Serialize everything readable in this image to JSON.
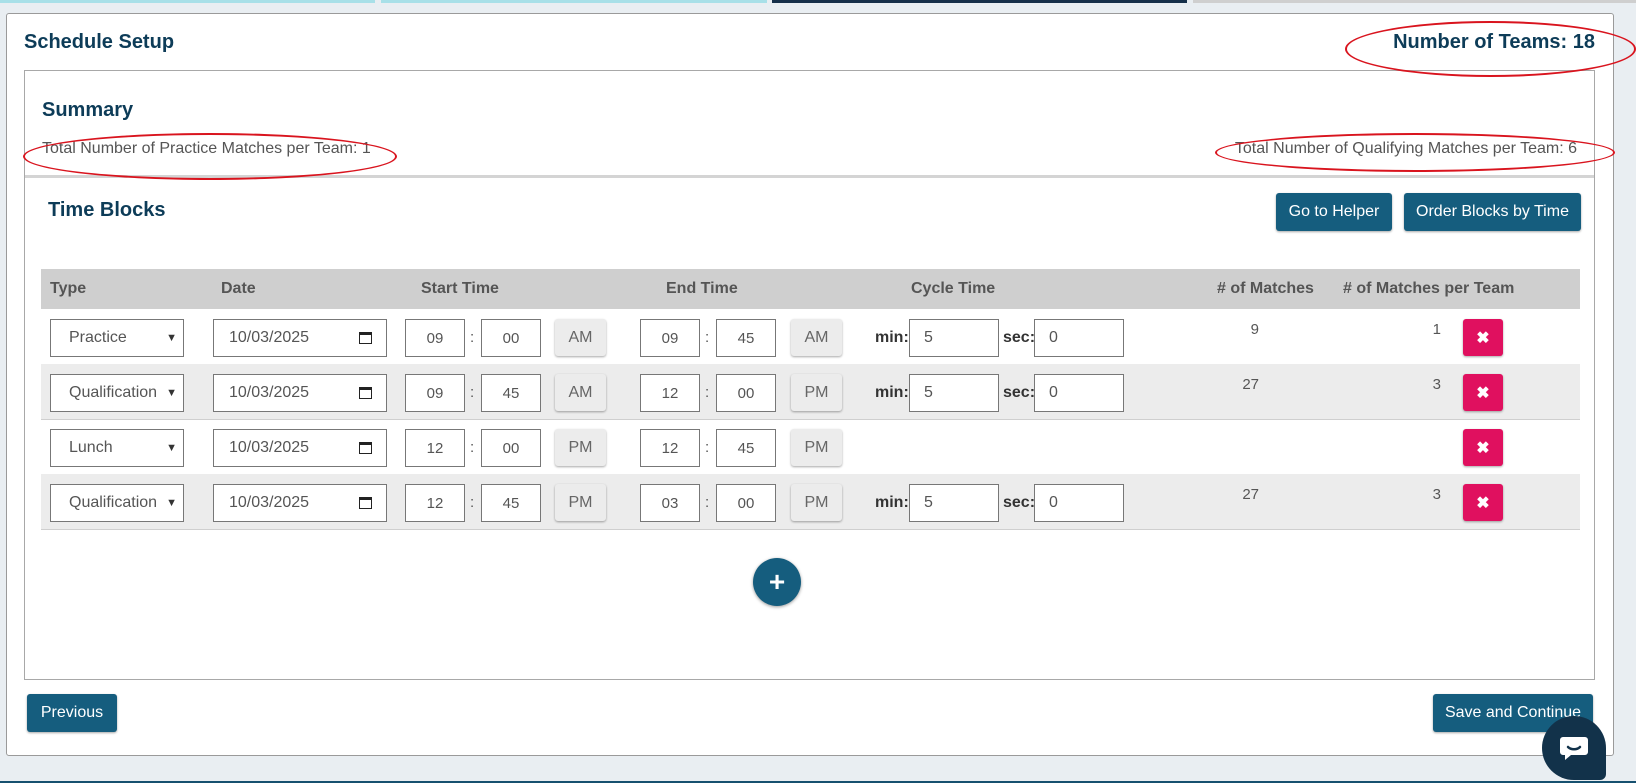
{
  "colors": {
    "primary": "#155d7e",
    "heading": "#0d3c58",
    "danger": "#e0105f",
    "highlight_oval": "#d9141e",
    "tab_bar_1": "#a8e0e8",
    "tab_bar_2": "#a8e0e8",
    "tab_bar_3": "#16304a",
    "tab_bar_4": "#cfcfcf"
  },
  "page": {
    "title": "Schedule Setup",
    "teams_label": "Number of Teams: 18"
  },
  "summary": {
    "title": "Summary",
    "practice_text": "Total Number of Practice Matches per Team: 1",
    "qualifying_text": "Total Number of Qualifying Matches per Team: 6"
  },
  "time_blocks": {
    "title": "Time Blocks",
    "helper_button": "Go to Helper",
    "order_button": "Order Blocks by Time",
    "columns": {
      "type": "Type",
      "date": "Date",
      "start": "Start Time",
      "end": "End Time",
      "cycle": "Cycle Time",
      "matches": "# of Matches",
      "per_team": "# of Matches per Team"
    },
    "min_label": "min:",
    "sec_label": "sec:",
    "rows": [
      {
        "type": "Practice",
        "date": "10/03/2025",
        "start_h": "09",
        "start_m": "00",
        "start_ampm": "AM",
        "end_h": "09",
        "end_m": "45",
        "end_ampm": "AM",
        "min": "5",
        "sec": "0",
        "matches": "9",
        "per_team": "1"
      },
      {
        "type": "Qualification",
        "date": "10/03/2025",
        "start_h": "09",
        "start_m": "45",
        "start_ampm": "AM",
        "end_h": "12",
        "end_m": "00",
        "end_ampm": "PM",
        "min": "5",
        "sec": "0",
        "matches": "27",
        "per_team": "3"
      },
      {
        "type": "Lunch",
        "date": "10/03/2025",
        "start_h": "12",
        "start_m": "00",
        "start_ampm": "PM",
        "end_h": "12",
        "end_m": "45",
        "end_ampm": "PM"
      },
      {
        "type": "Qualification",
        "date": "10/03/2025",
        "start_h": "12",
        "start_m": "45",
        "start_ampm": "PM",
        "end_h": "03",
        "end_m": "00",
        "end_ampm": "PM",
        "min": "5",
        "sec": "0",
        "matches": "27",
        "per_team": "3"
      }
    ],
    "icons": {
      "delete": "close-icon",
      "add": "plus-icon",
      "select": "chevron-down-icon",
      "date": "calendar-icon"
    }
  },
  "footer": {
    "previous": "Previous",
    "save": "Save and Continue"
  },
  "chat": {
    "icon": "chat-icon"
  }
}
